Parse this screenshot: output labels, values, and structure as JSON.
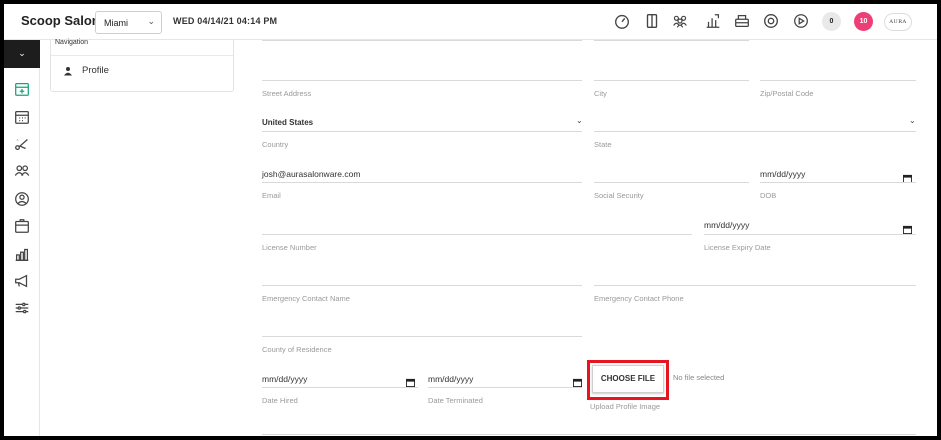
{
  "header": {
    "brand": "Scoop Salon",
    "location": "Miami",
    "datetime": "WED 04/14/21  04:14 PM",
    "icons": [
      "speedometer-icon",
      "door-icon",
      "users-group-icon",
      "reports-icon",
      "register-icon",
      "support-icon",
      "play-icon"
    ],
    "badge_count_grey": "0",
    "badge_count_pink": "10",
    "logo_text": "AURA"
  },
  "rail": {
    "toggle_icon": "chevron-down-icon",
    "icons": [
      "add-appointment-icon",
      "calendar-icon",
      "scissors-icon",
      "clients-icon",
      "account-icon",
      "package-icon",
      "analytics-icon",
      "marketing-icon",
      "settings-sliders-icon"
    ]
  },
  "navigation": {
    "title": "Navigation",
    "items": [
      {
        "label": "Profile",
        "icon": "person-icon"
      }
    ]
  },
  "form": {
    "street_address": {
      "label": "Street Address",
      "value": ""
    },
    "city": {
      "label": "City",
      "value": ""
    },
    "zip": {
      "label": "Zip/Postal Code",
      "value": ""
    },
    "country": {
      "label": "Country",
      "value": "United States"
    },
    "state": {
      "label": "State",
      "value": ""
    },
    "email": {
      "label": "Email",
      "value": "josh@aurasalonware.com"
    },
    "social_security": {
      "label": "Social Security",
      "value": ""
    },
    "dob": {
      "label": "DOB",
      "placeholder": "mm/dd/yyyy"
    },
    "license_number": {
      "label": "License Number",
      "value": ""
    },
    "license_expiry": {
      "label": "License Expiry Date",
      "placeholder": "mm/dd/yyyy"
    },
    "emergency_name": {
      "label": "Emergency Contact Name",
      "value": ""
    },
    "emergency_phone": {
      "label": "Emergency Contact Phone",
      "value": ""
    },
    "county": {
      "label": "County of Residence",
      "value": ""
    },
    "date_hired": {
      "label": "Date Hired",
      "placeholder": "mm/dd/yyyy"
    },
    "date_terminated": {
      "label": "Date Terminated",
      "placeholder": "mm/dd/yyyy"
    },
    "upload": {
      "button_label": "CHOOSE FILE",
      "status": "No file selected",
      "label": "Upload Profile Image"
    }
  },
  "colors": {
    "highlight": "#e8141f",
    "badge_pink": "#ee3e78",
    "rail_active": "#1d1d1d"
  }
}
